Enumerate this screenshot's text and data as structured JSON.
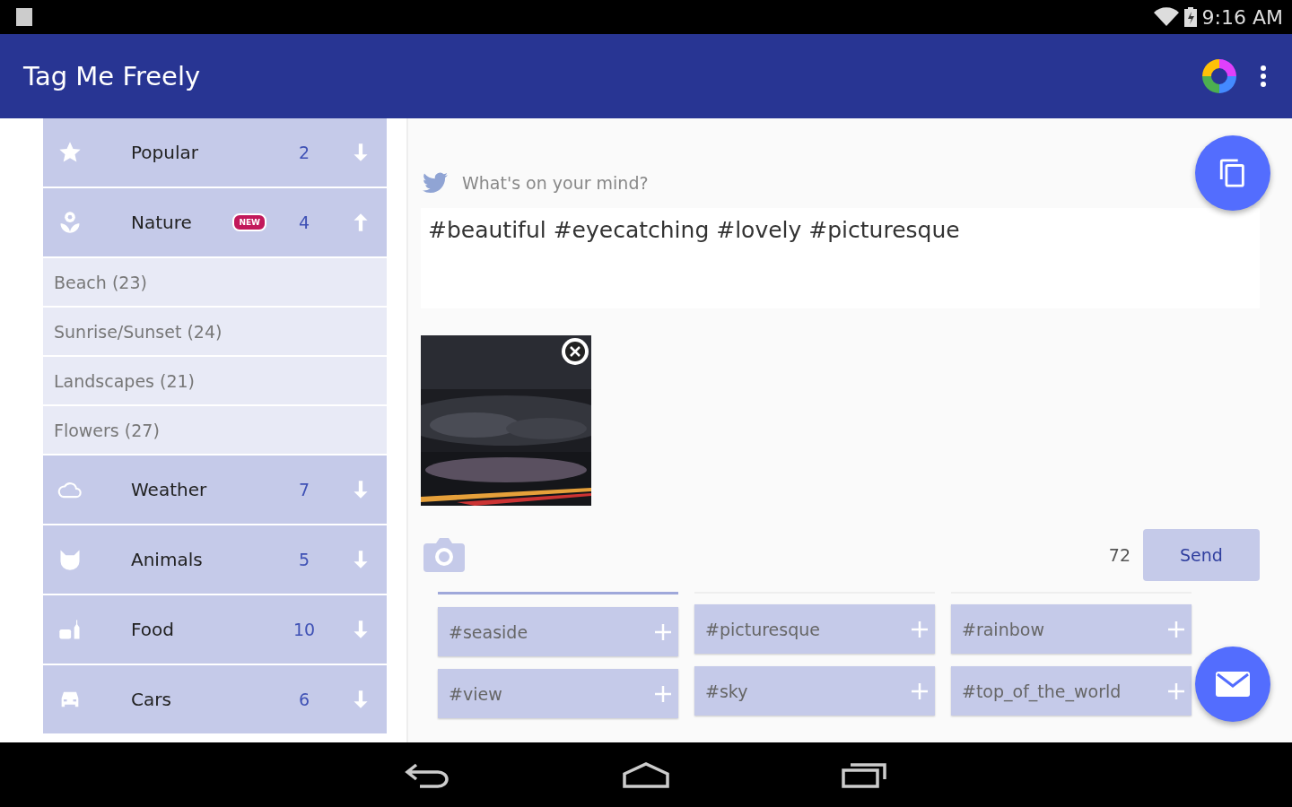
{
  "status_bar": {
    "time": "9:16 AM"
  },
  "app_bar": {
    "title": "Tag Me Freely"
  },
  "categories": [
    {
      "label": "Popular",
      "count": "2",
      "expanded": false
    },
    {
      "label": "Nature",
      "badge": "NEW",
      "count": "4",
      "expanded": true,
      "children": [
        "Beach (23)",
        "Sunrise/Sunset (24)",
        "Landscapes (21)",
        "Flowers (27)"
      ]
    },
    {
      "label": "Weather",
      "count": "7",
      "expanded": false
    },
    {
      "label": "Animals",
      "count": "5",
      "expanded": false
    },
    {
      "label": "Food",
      "count": "10",
      "expanded": false
    },
    {
      "label": "Cars",
      "count": "6",
      "expanded": false
    }
  ],
  "compose": {
    "label": "What's on your mind?",
    "value": "#beautiful #eyecatching #lovely #picturesque",
    "remaining": "72",
    "send": "Send"
  },
  "tag_columns": [
    {
      "selected": true,
      "tags": [
        "#seaside",
        "#view"
      ]
    },
    {
      "selected": false,
      "tags": [
        "#picturesque",
        "#sky"
      ]
    },
    {
      "selected": false,
      "tags": [
        "#rainbow",
        "#top_of_the_world"
      ]
    }
  ]
}
